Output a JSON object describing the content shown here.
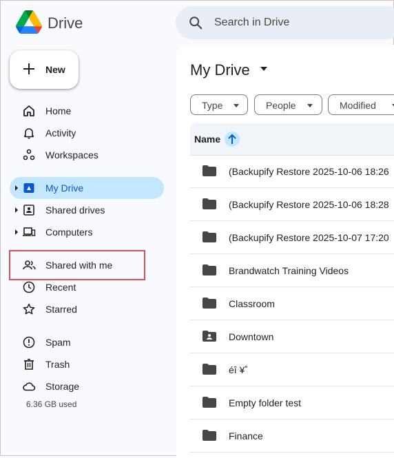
{
  "app": {
    "title": "Drive"
  },
  "search": {
    "placeholder": "Search in Drive"
  },
  "new_button": {
    "label": "New"
  },
  "nav": {
    "items": [
      {
        "label": "Home",
        "icon": "home-icon"
      },
      {
        "label": "Activity",
        "icon": "bell-icon"
      },
      {
        "label": "Workspaces",
        "icon": "workspaces-icon"
      },
      {
        "label": "My Drive",
        "icon": "my-drive-icon",
        "active": true,
        "expandable": true
      },
      {
        "label": "Shared drives",
        "icon": "shared-drives-icon",
        "expandable": true
      },
      {
        "label": "Computers",
        "icon": "computers-icon",
        "expandable": true
      },
      {
        "label": "Shared with me",
        "icon": "people-icon"
      },
      {
        "label": "Recent",
        "icon": "clock-icon"
      },
      {
        "label": "Starred",
        "icon": "star-icon"
      },
      {
        "label": "Spam",
        "icon": "spam-icon"
      },
      {
        "label": "Trash",
        "icon": "trash-icon"
      },
      {
        "label": "Storage",
        "icon": "cloud-icon"
      }
    ],
    "storage_used": "6.36 GB used"
  },
  "main": {
    "title": "My Drive",
    "filters": [
      "Type",
      "People",
      "Modified"
    ],
    "table": {
      "name_header": "Name",
      "rows": [
        {
          "name": "(Backupify Restore 2025-10-06 18:26",
          "icon": "folder-icon"
        },
        {
          "name": "(Backupify Restore 2025-10-06 18:28",
          "icon": "folder-icon"
        },
        {
          "name": "(Backupify Restore 2025-10-07 17:20",
          "icon": "folder-icon"
        },
        {
          "name": "Brandwatch Training Videos",
          "icon": "folder-icon"
        },
        {
          "name": "Classroom",
          "icon": "folder-icon"
        },
        {
          "name": "Downtown",
          "icon": "shared-folder-icon"
        },
        {
          "name": "éî ¥˚",
          "icon": "folder-icon"
        },
        {
          "name": "Empty folder test",
          "icon": "folder-icon"
        },
        {
          "name": "Finance",
          "icon": "folder-icon"
        }
      ]
    }
  },
  "colors": {
    "accent": "#0b57d0",
    "active_bg": "#c2e7ff",
    "highlight_box": "#e04a55"
  }
}
